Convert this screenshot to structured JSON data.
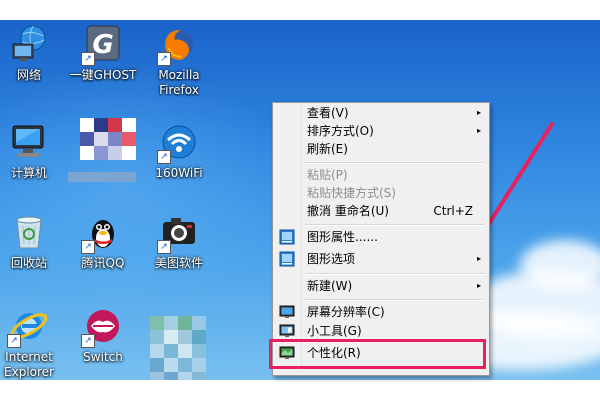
{
  "desktop": {
    "icons": [
      {
        "label": "网络",
        "icon": "network-icon"
      },
      {
        "label": "一键GHOST",
        "icon": "ghost-icon"
      },
      {
        "label": "Mozilla Firefox",
        "icon": "firefox-icon"
      },
      {
        "label": "计算机",
        "icon": "computer-icon"
      },
      {
        "label": "160WiFi",
        "icon": "wifi-icon"
      },
      {
        "label": "回收站",
        "icon": "recycle-bin-icon"
      },
      {
        "label": "腾讯QQ",
        "icon": "qq-icon"
      },
      {
        "label": "美图软件",
        "icon": "camera-icon"
      },
      {
        "label": "Internet Explorer",
        "icon": "internet-explorer-icon"
      },
      {
        "label": "Switch",
        "icon": "lips-icon"
      }
    ]
  },
  "context_menu": {
    "items": [
      {
        "label": "查看(V)",
        "submenu": true,
        "disabled": false
      },
      {
        "label": "排序方式(O)",
        "submenu": true,
        "disabled": false
      },
      {
        "label": "刷新(E)",
        "submenu": false,
        "disabled": false
      },
      {
        "label": "粘贴(P)",
        "submenu": false,
        "disabled": true
      },
      {
        "label": "粘贴快捷方式(S)",
        "submenu": false,
        "disabled": true
      },
      {
        "label": "撤消 重命名(U)",
        "shortcut": "Ctrl+Z",
        "submenu": false,
        "disabled": false
      },
      {
        "label": "图形属性......",
        "submenu": false,
        "disabled": false,
        "icon": "graphics-properties-icon"
      },
      {
        "label": "图形选项",
        "submenu": true,
        "disabled": false,
        "icon": "graphics-options-icon"
      },
      {
        "label": "新建(W)",
        "submenu": true,
        "disabled": false
      },
      {
        "label": "屏幕分辨率(C)",
        "submenu": false,
        "disabled": false,
        "icon": "screen-resolution-icon"
      },
      {
        "label": "小工具(G)",
        "submenu": false,
        "disabled": false,
        "icon": "gadgets-icon"
      },
      {
        "label": "个性化(R)",
        "submenu": false,
        "disabled": false,
        "icon": "personalize-icon",
        "highlighted": true
      }
    ],
    "submenu_glyph": "▸"
  },
  "colors": {
    "highlight_border": "#e8215e",
    "arrow": "#e8215e",
    "menu_background": "#f0f0f0"
  }
}
